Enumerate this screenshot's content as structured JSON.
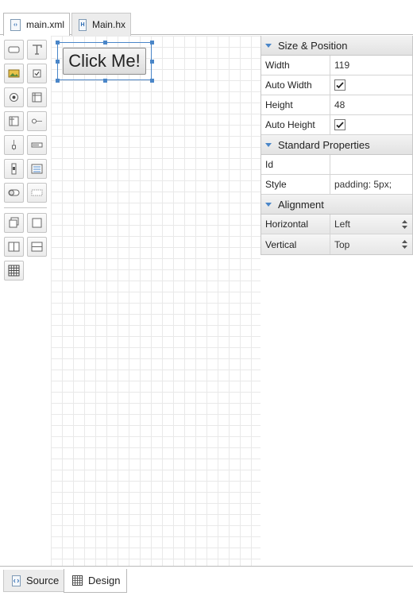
{
  "tabs": [
    {
      "label": "main.xml",
      "icon": "xml-file-icon",
      "active": true
    },
    {
      "label": "Main.hx",
      "icon": "haxe-file-icon",
      "active": false
    }
  ],
  "canvas": {
    "button_label": "Click Me!"
  },
  "properties": {
    "sections": [
      {
        "title": "Size & Position"
      },
      {
        "title": "Standard Properties"
      },
      {
        "title": "Alignment"
      }
    ],
    "size": {
      "width_label": "Width",
      "width_value": "119",
      "auto_width_label": "Auto Width",
      "auto_width": true,
      "height_label": "Height",
      "height_value": "48",
      "auto_height_label": "Auto Height",
      "auto_height": true
    },
    "standard": {
      "id_label": "Id",
      "id_value": "",
      "style_label": "Style",
      "style_value": "padding: 5px;"
    },
    "alignment": {
      "horizontal_label": "Horizontal",
      "horizontal_value": "Left",
      "vertical_label": "Vertical",
      "vertical_value": "Top"
    }
  },
  "bottom_tabs": [
    {
      "label": "Source",
      "icon": "source-icon",
      "active": false
    },
    {
      "label": "Design",
      "icon": "grid-icon",
      "active": true
    }
  ],
  "colors": {
    "accent": "#4a86c8",
    "border": "#c8c8c8",
    "grid": "#e9e9e9"
  }
}
